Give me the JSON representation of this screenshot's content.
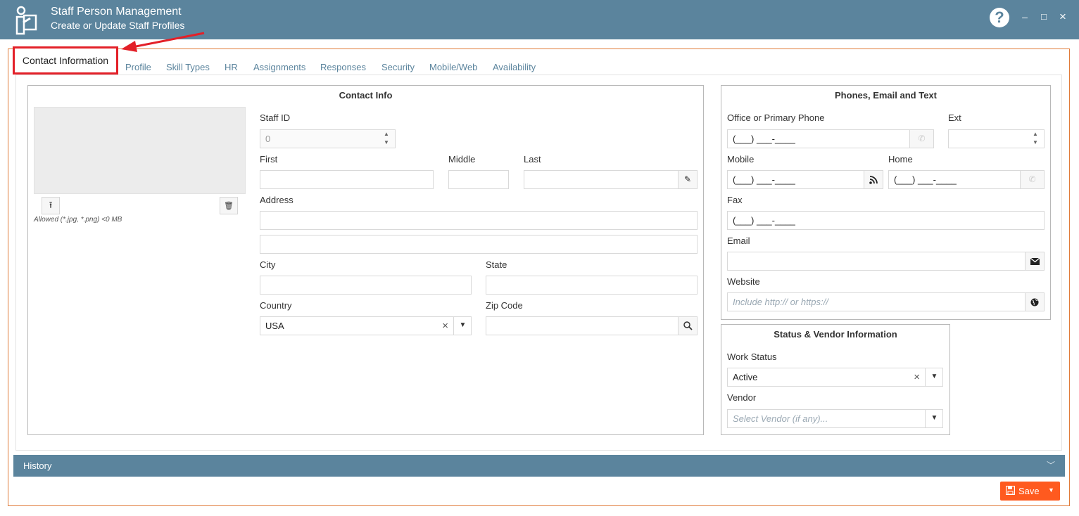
{
  "app": {
    "title": "Staff Person Management",
    "subtitle": "Create or Update Staff Profiles",
    "help_symbol": "?",
    "minimize_symbol": "–",
    "maximize_symbol": "□",
    "close_symbol": "×",
    "icon": "staff-person-icon"
  },
  "tabs": {
    "active": "Contact Information",
    "items": [
      "Profile",
      "Skill Types",
      "HR",
      "Assignments",
      "Responses",
      "Security",
      "Mobile/Web",
      "Availability"
    ]
  },
  "contact_info": {
    "title": "Contact Info",
    "photo_hint": "Allowed (*.jpg, *.png) <0 MB",
    "upload_symbol": "⭱",
    "delete_symbol": "🗑",
    "staff_id_label": "Staff ID",
    "staff_id_value": "0",
    "first_label": "First",
    "middle_label": "Middle",
    "last_label": "Last",
    "address_label": "Address",
    "city_label": "City",
    "state_label": "State",
    "country_label": "Country",
    "country_value": "USA",
    "zip_label": "Zip Code"
  },
  "phones": {
    "title": "Phones, Email and Text",
    "office_label": "Office or Primary Phone",
    "office_value": "(___) ___-____",
    "ext_label": "Ext",
    "mobile_label": "Mobile",
    "mobile_value": "(___) ___-____",
    "home_label": "Home",
    "home_value": "(___) ___-____",
    "fax_label": "Fax",
    "fax_value": "(___) ___-____",
    "email_label": "Email",
    "website_label": "Website",
    "website_placeholder": "Include http:// or https://"
  },
  "status": {
    "title": "Status & Vendor Information",
    "work_status_label": "Work Status",
    "work_status_value": "Active",
    "vendor_label": "Vendor",
    "vendor_placeholder": "Select Vendor (if any)..."
  },
  "history": {
    "label": "History"
  },
  "save": {
    "label": "Save"
  },
  "colors": {
    "header": "#5b849d",
    "accent": "#ff5a1f",
    "highlight": "#e32028"
  }
}
